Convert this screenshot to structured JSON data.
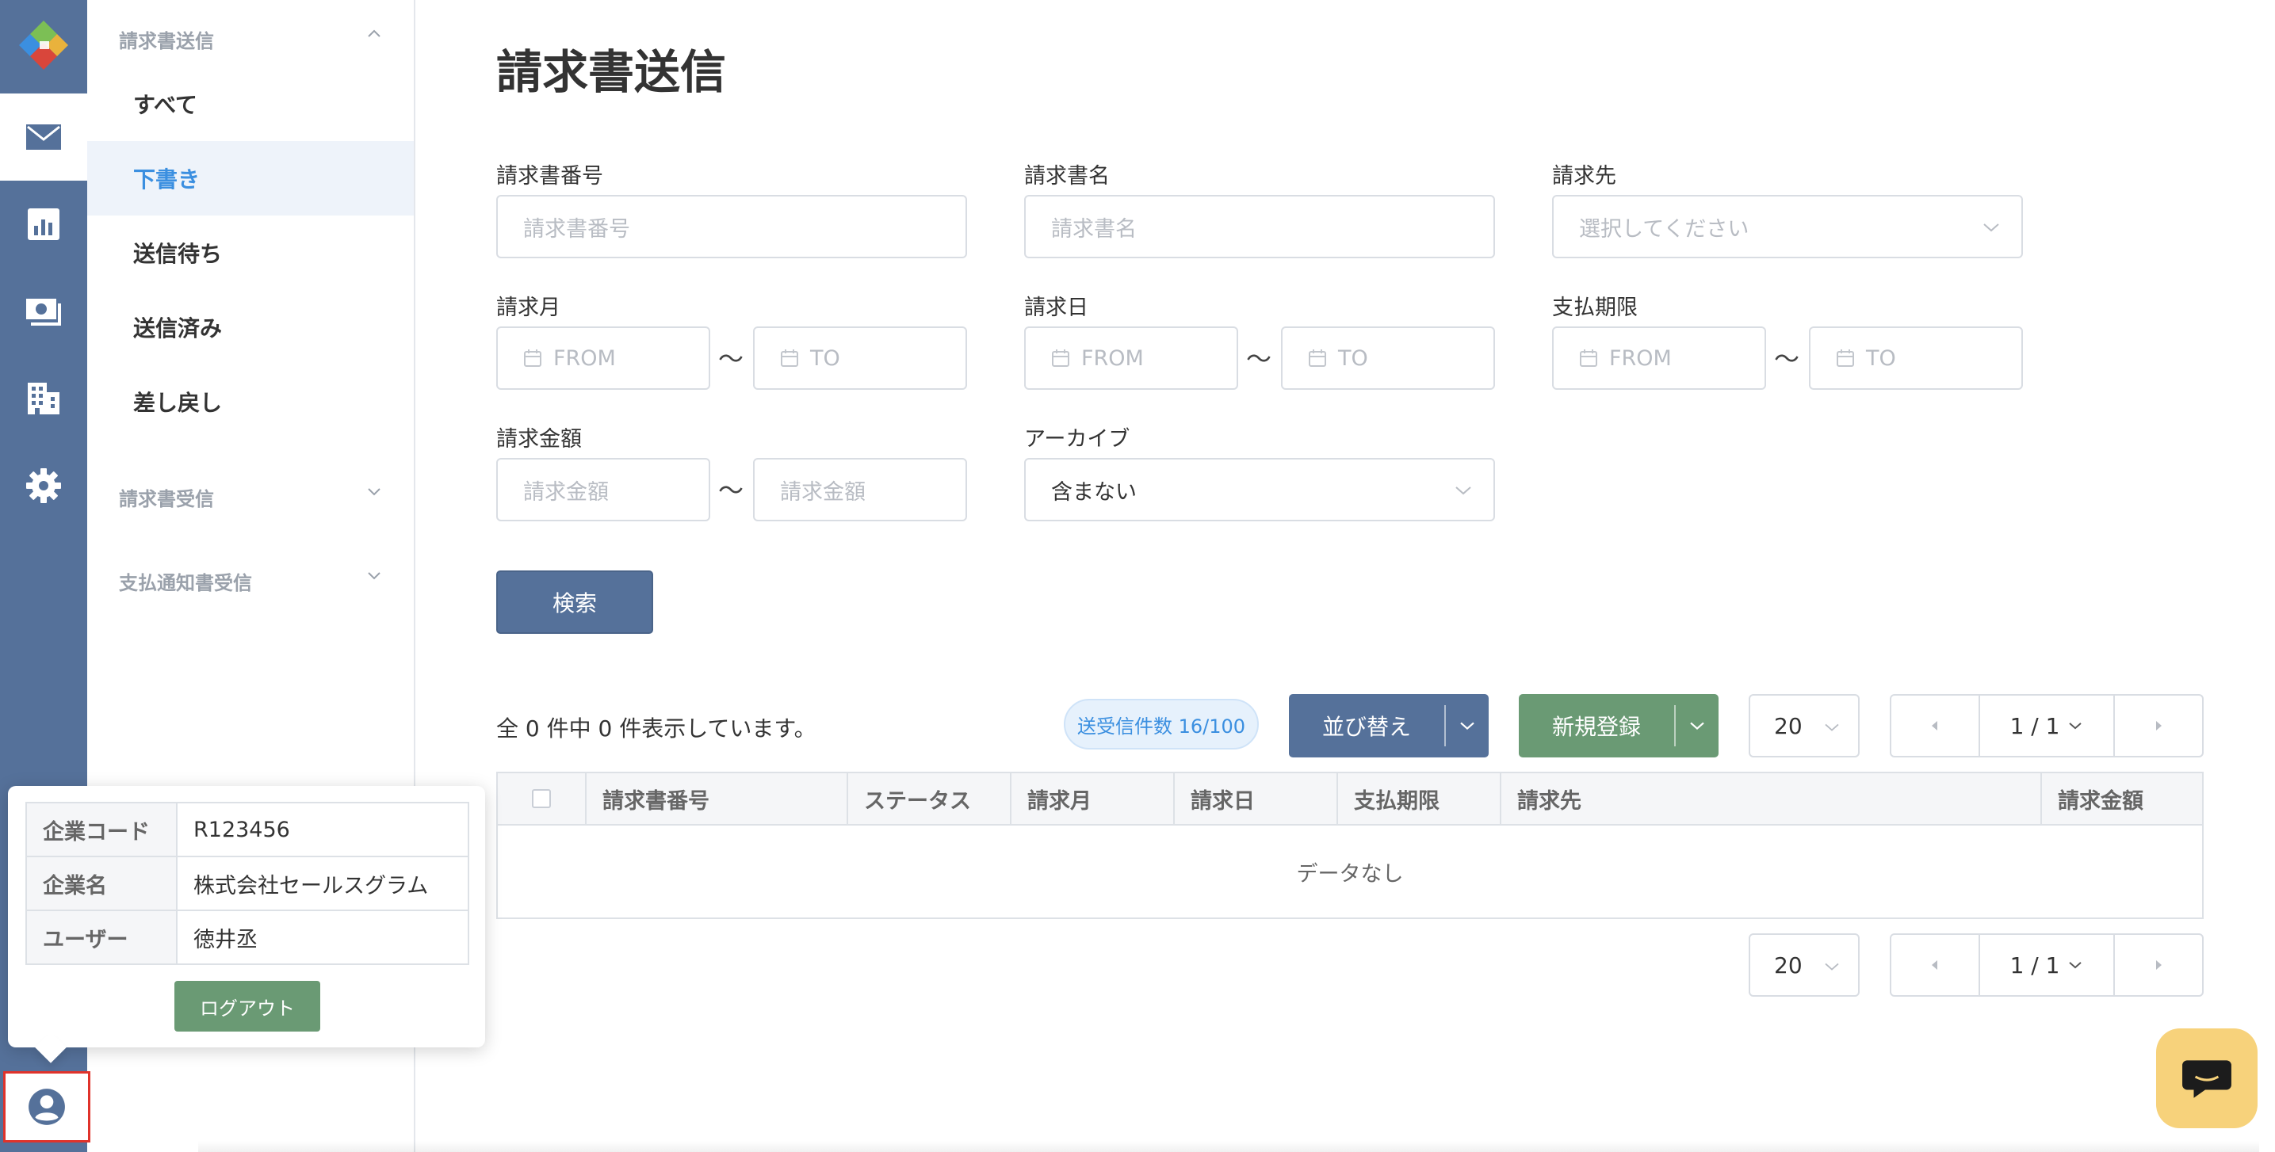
{
  "sidebar": {
    "groups": [
      {
        "label": "請求書送信",
        "expanded": true,
        "items": [
          {
            "label": "すべて"
          },
          {
            "label": "下書き",
            "active": true
          },
          {
            "label": "送信待ち"
          },
          {
            "label": "送信済み"
          },
          {
            "label": "差し戻し"
          }
        ]
      },
      {
        "label": "請求書受信",
        "expanded": false
      },
      {
        "label": "支払通知書受信",
        "expanded": false
      }
    ]
  },
  "page": {
    "title": "請求書送信"
  },
  "filters": {
    "invoice_number": {
      "label": "請求書番号",
      "placeholder": "請求書番号"
    },
    "invoice_name": {
      "label": "請求書名",
      "placeholder": "請求書名"
    },
    "billing_to": {
      "label": "請求先",
      "placeholder": "選択してください"
    },
    "billing_month": {
      "label": "請求月",
      "from": "FROM",
      "to": "TO"
    },
    "billing_date": {
      "label": "請求日",
      "from": "FROM",
      "to": "TO"
    },
    "payment_due": {
      "label": "支払期限",
      "from": "FROM",
      "to": "TO"
    },
    "amount": {
      "label": "請求金額",
      "from_placeholder": "請求金額",
      "to_placeholder": "請求金額"
    },
    "archive": {
      "label": "アーカイブ",
      "value": "含まない"
    },
    "range_sep": "〜",
    "search_button": "検索"
  },
  "results": {
    "count_text": "全 0 件中 0 件表示しています。",
    "quota_badge": "送受信件数 16/100",
    "sort_button": "並び替え",
    "new_button": "新規登録",
    "page_size": "20",
    "page_indicator": "1 / 1",
    "columns": [
      "請求書番号",
      "ステータス",
      "請求月",
      "請求日",
      "支払期限",
      "請求先",
      "請求金額"
    ],
    "empty_text": "データなし"
  },
  "user_popover": {
    "rows": [
      {
        "key": "企業コード",
        "value": "R123456"
      },
      {
        "key": "企業名",
        "value": "株式会社セールスグラム"
      },
      {
        "key": "ユーザー",
        "value": "徳井丞"
      }
    ],
    "logout_button": "ログアウト"
  },
  "colors": {
    "rail": "#55719a",
    "primary_button": "#55719a",
    "success_button": "#6a9a74",
    "active_link": "#3b8fe0",
    "chat_button": "#f7d27b",
    "highlight_border": "#e0332b"
  },
  "icons": {
    "rail": [
      "app-logo-icon",
      "mail-icon",
      "chart-icon",
      "payment-icon",
      "building-icon",
      "gear-icon",
      "user-circle-icon"
    ],
    "chat": "chat-icon"
  }
}
